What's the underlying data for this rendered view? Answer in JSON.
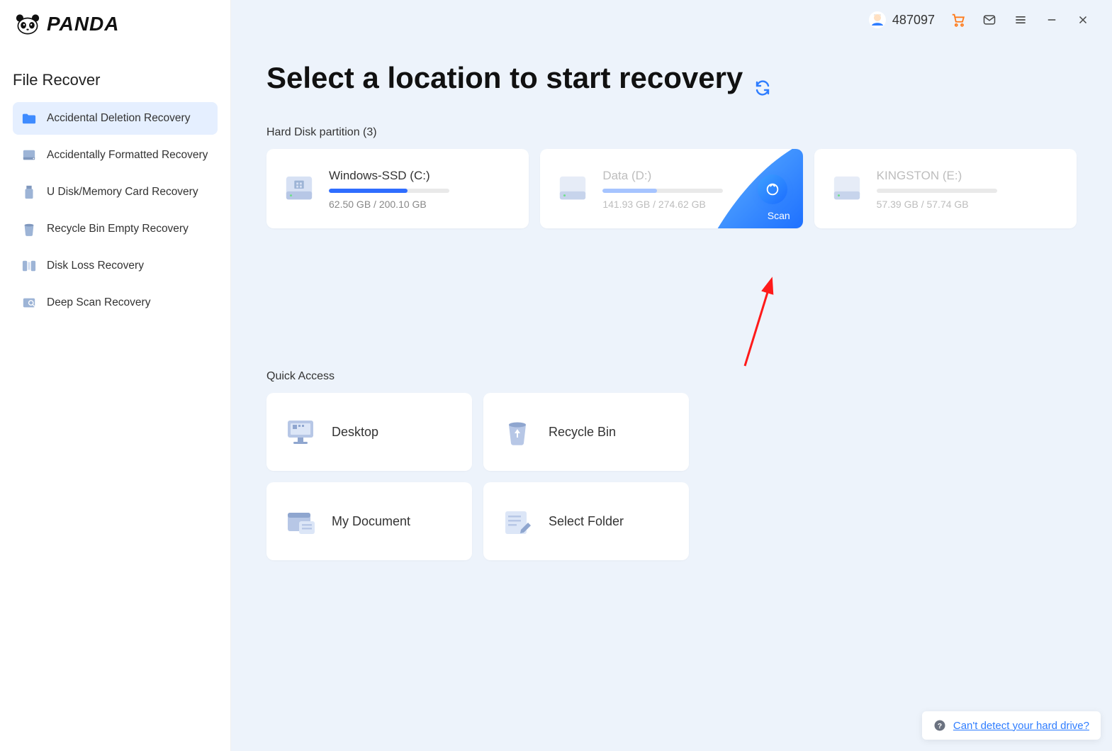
{
  "brand": "PANDA",
  "sidebar": {
    "title": "File Recover",
    "items": [
      {
        "label": "Accidental Deletion Recovery",
        "icon": "folder-icon",
        "active": true
      },
      {
        "label": "Accidentally Formatted Recovery",
        "icon": "disk-icon",
        "active": false
      },
      {
        "label": "U Disk/Memory Card Recovery",
        "icon": "usb-icon",
        "active": false
      },
      {
        "label": "Recycle Bin Empty Recovery",
        "icon": "bin-icon",
        "active": false
      },
      {
        "label": "Disk Loss Recovery",
        "icon": "mirror-icon",
        "active": false
      },
      {
        "label": "Deep Scan Recovery",
        "icon": "deepscan-icon",
        "active": false
      }
    ]
  },
  "topbar": {
    "user_id": "487097"
  },
  "page": {
    "title": "Select a location to start recovery",
    "partition_section_label": "Hard Disk partition   (3)",
    "quick_section_label": "Quick Access",
    "scan_label": "Scan",
    "help_link": "Can't detect your hard drive?"
  },
  "partitions": [
    {
      "name": "Windows-SSD   (C:)",
      "used": "62.50 GB",
      "total": "200.10 GB",
      "usage_text": "62.50 GB / 200.10 GB",
      "fill_pct": 65,
      "faded": false,
      "fill_style": "solid",
      "hovered": false
    },
    {
      "name": "Data   (D:)",
      "used": "141.93 GB",
      "total": "274.62 GB",
      "usage_text": "141.93 GB / 274.62 GB",
      "fill_pct": 45,
      "faded": true,
      "fill_style": "light",
      "hovered": true
    },
    {
      "name": "KINGSTON   (E:)",
      "used": "57.39 GB",
      "total": "57.74 GB",
      "usage_text": "57.39 GB / 57.74 GB",
      "fill_pct": 0,
      "faded": true,
      "fill_style": "light",
      "hovered": false
    }
  ],
  "quick_access": [
    {
      "name": "Desktop",
      "icon": "desktop-icon"
    },
    {
      "name": "Recycle Bin",
      "icon": "recyclebin-icon"
    },
    {
      "name": "My Document",
      "icon": "document-icon"
    },
    {
      "name": "Select Folder",
      "icon": "selectfolder-icon"
    }
  ]
}
